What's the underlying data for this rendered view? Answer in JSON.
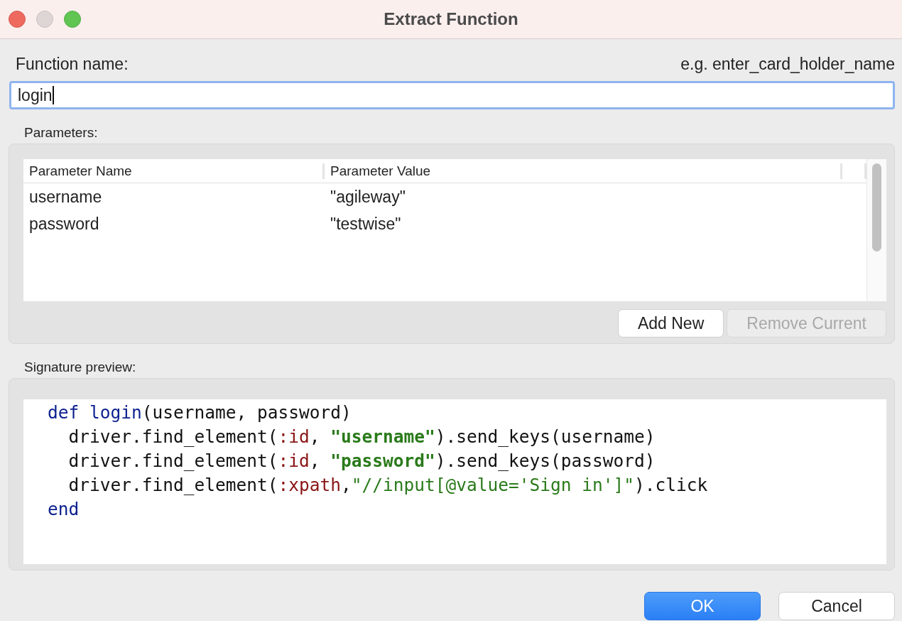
{
  "window": {
    "title": "Extract Function"
  },
  "function_name": {
    "label": "Function name:",
    "hint": "e.g. enter_card_holder_name",
    "value": "login"
  },
  "parameters": {
    "label": "Parameters:",
    "columns": [
      "Parameter Name",
      "Parameter Value"
    ],
    "rows": [
      {
        "name": "username",
        "value": "\"agileway\""
      },
      {
        "name": "password",
        "value": "\"testwise\""
      }
    ],
    "buttons": [
      {
        "label": "Add New",
        "disabled": false
      },
      {
        "label": "Remove Current",
        "disabled": true
      }
    ]
  },
  "signature": {
    "label": "Signature preview:",
    "lines": [
      [
        {
          "kind": "keyword",
          "text": "def login"
        },
        {
          "kind": "plain",
          "text": "(username, password)"
        }
      ],
      [
        {
          "kind": "plain",
          "text": "  driver.find_element("
        },
        {
          "kind": "symbol",
          "text": ":id"
        },
        {
          "kind": "plain",
          "text": ", "
        },
        {
          "kind": "string",
          "text": "\"username\""
        },
        {
          "kind": "plain",
          "text": ").send_keys(username)"
        }
      ],
      [
        {
          "kind": "plain",
          "text": "  driver.find_element("
        },
        {
          "kind": "symbol",
          "text": ":id"
        },
        {
          "kind": "plain",
          "text": ", "
        },
        {
          "kind": "string",
          "text": "\"password\""
        },
        {
          "kind": "plain",
          "text": ").send_keys(password)"
        }
      ],
      [
        {
          "kind": "plain",
          "text": "  driver.find_element("
        },
        {
          "kind": "symbol",
          "text": ":xpath"
        },
        {
          "kind": "plain",
          "text": ","
        },
        {
          "kind": "string2",
          "text": "\"//input[@value='Sign in']\""
        },
        {
          "kind": "plain",
          "text": ").click"
        }
      ],
      [
        {
          "kind": "keyword",
          "text": "end"
        }
      ]
    ]
  },
  "buttons": [
    {
      "label": "OK",
      "kind": "primary"
    },
    {
      "label": "Cancel",
      "kind": "normal"
    }
  ]
}
